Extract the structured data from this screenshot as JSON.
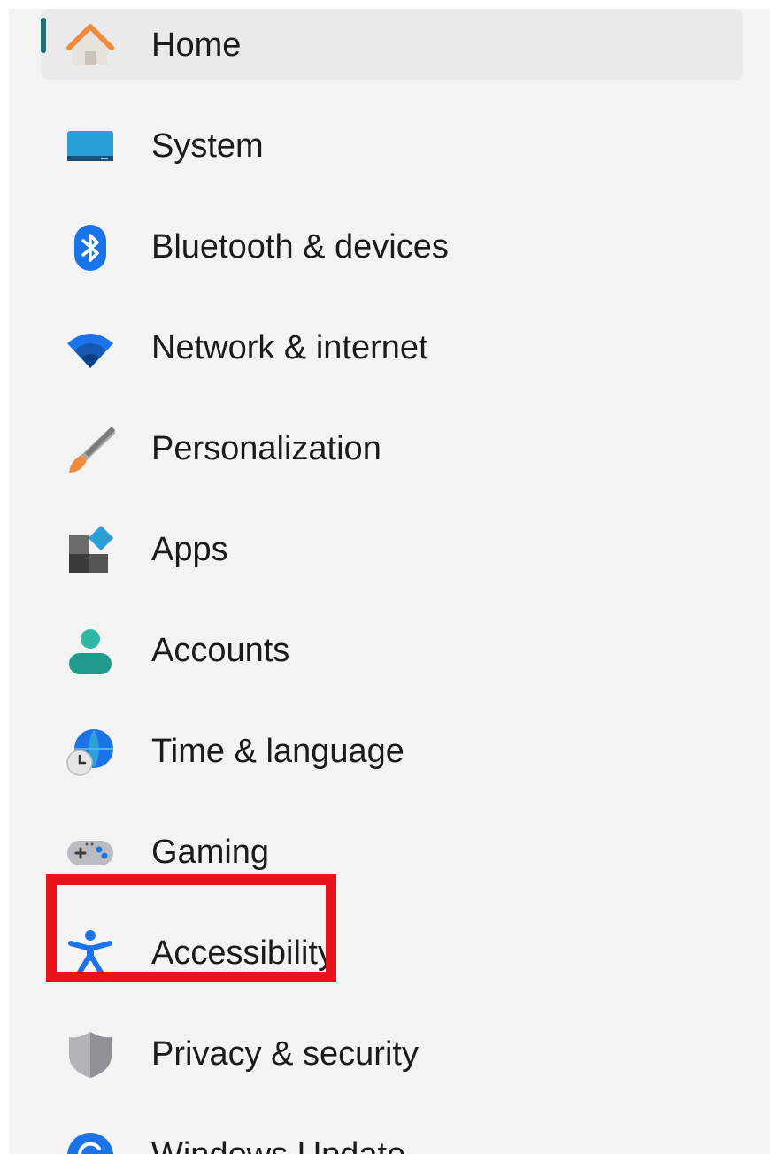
{
  "nav": {
    "items": [
      {
        "label": "Home",
        "icon": "home-icon",
        "selected": true
      },
      {
        "label": "System",
        "icon": "system-icon",
        "selected": false
      },
      {
        "label": "Bluetooth & devices",
        "icon": "bluetooth-icon",
        "selected": false
      },
      {
        "label": "Network & internet",
        "icon": "wifi-icon",
        "selected": false
      },
      {
        "label": "Personalization",
        "icon": "brush-icon",
        "selected": false
      },
      {
        "label": "Apps",
        "icon": "apps-icon",
        "selected": false
      },
      {
        "label": "Accounts",
        "icon": "account-icon",
        "selected": false
      },
      {
        "label": "Time & language",
        "icon": "globe-clock-icon",
        "selected": false
      },
      {
        "label": "Gaming",
        "icon": "controller-icon",
        "selected": false
      },
      {
        "label": "Accessibility",
        "icon": "accessibility-icon",
        "selected": false,
        "highlighted": true
      },
      {
        "label": "Privacy & security",
        "icon": "shield-icon",
        "selected": false
      },
      {
        "label": "Windows Update",
        "icon": "update-icon",
        "selected": false
      }
    ]
  },
  "colors": {
    "selection_indicator": "#1f6f73",
    "highlight_box": "#e8141c",
    "pane_background": "#f3f3f3"
  }
}
